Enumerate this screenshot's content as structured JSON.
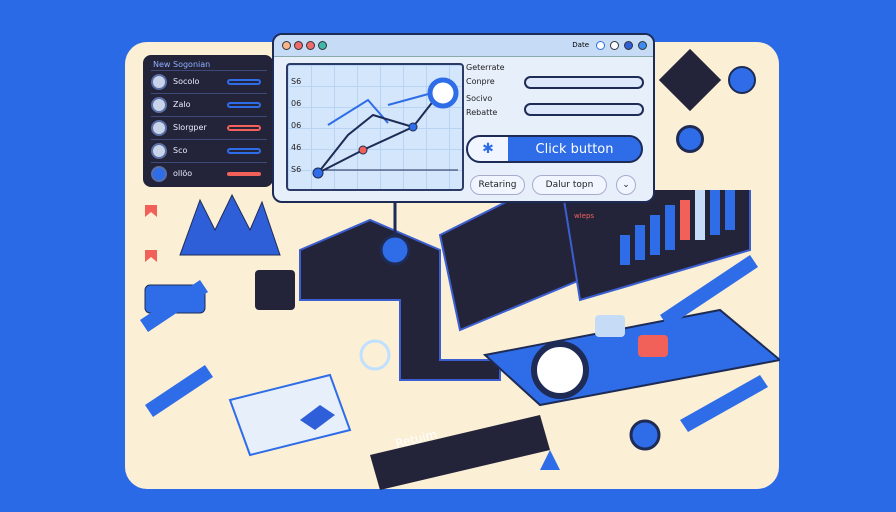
{
  "sidebar": {
    "title": "New Sogonian",
    "items": [
      {
        "label": "Socolo"
      },
      {
        "label": "Zalo"
      },
      {
        "label": "Slorgper"
      },
      {
        "label": "Sco"
      },
      {
        "label": "ollöo"
      }
    ]
  },
  "window": {
    "header_label": "Date",
    "chart": {
      "y_ticks": [
        "S6",
        "06",
        "06",
        "46",
        "S6"
      ]
    },
    "form": {
      "labels": [
        "Geterrate",
        "Conpre",
        "Socivo",
        "Rebatte"
      ]
    },
    "click_button": "Click button",
    "pill_1": "Retaring",
    "pill_2": "Dalur topn"
  },
  "dashboard": {
    "label": "wleps",
    "bars_accent": "#f2605a"
  },
  "card": {
    "return_label": "Retuim"
  },
  "colors": {
    "background": "#2b6ae6",
    "board": "#fbefd6",
    "accent": "#2f6de8",
    "dark": "#23243a"
  }
}
